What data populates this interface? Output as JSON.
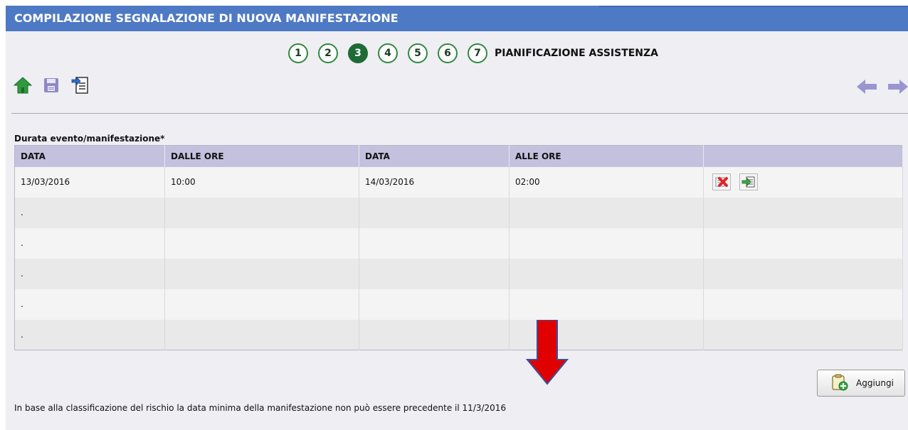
{
  "window": {
    "title": "COMPILAZIONE SEGNALAZIONE DI NUOVA MANIFESTAZIONE"
  },
  "wizard": {
    "steps": [
      "1",
      "2",
      "3",
      "4",
      "5",
      "6",
      "7"
    ],
    "active_step": "3",
    "current_step_label": "PIANIFICAZIONE ASSISTENZA"
  },
  "toolbar": {
    "icons": [
      "home-icon",
      "save-icon",
      "export-icon"
    ],
    "nav_icons": [
      "arrow-left-icon",
      "arrow-right-icon"
    ]
  },
  "section": {
    "label": "Durata evento/manifestazione*"
  },
  "table": {
    "headers": [
      "DATA",
      "DALLE ORE",
      "DATA",
      "ALLE ORE",
      ""
    ],
    "rows": [
      [
        "13/03/2016",
        "10:00",
        "14/03/2016",
        "02:00",
        ""
      ],
      [
        ".",
        "",
        "",
        "",
        ""
      ],
      [
        ".",
        "",
        "",
        "",
        ""
      ],
      [
        ".",
        "",
        "",
        "",
        ""
      ],
      [
        ".",
        "",
        "",
        "",
        ""
      ],
      [
        ".",
        "",
        "",
        "",
        ""
      ]
    ],
    "row_action_icons": [
      "delete-icon",
      "edit-icon"
    ]
  },
  "buttons": {
    "add_label": "Aggiungi"
  },
  "info": {
    "text": "In base alla classificazione del rischio la data minima della manifestazione non può essere precedente il 11/3/2016"
  },
  "colors": {
    "titlebar": "#4e79c4",
    "step_border": "#2f8a3e",
    "step_active": "#1f6b35",
    "header_row": "#c4c1df",
    "annotation_arrow": "#e00000"
  }
}
